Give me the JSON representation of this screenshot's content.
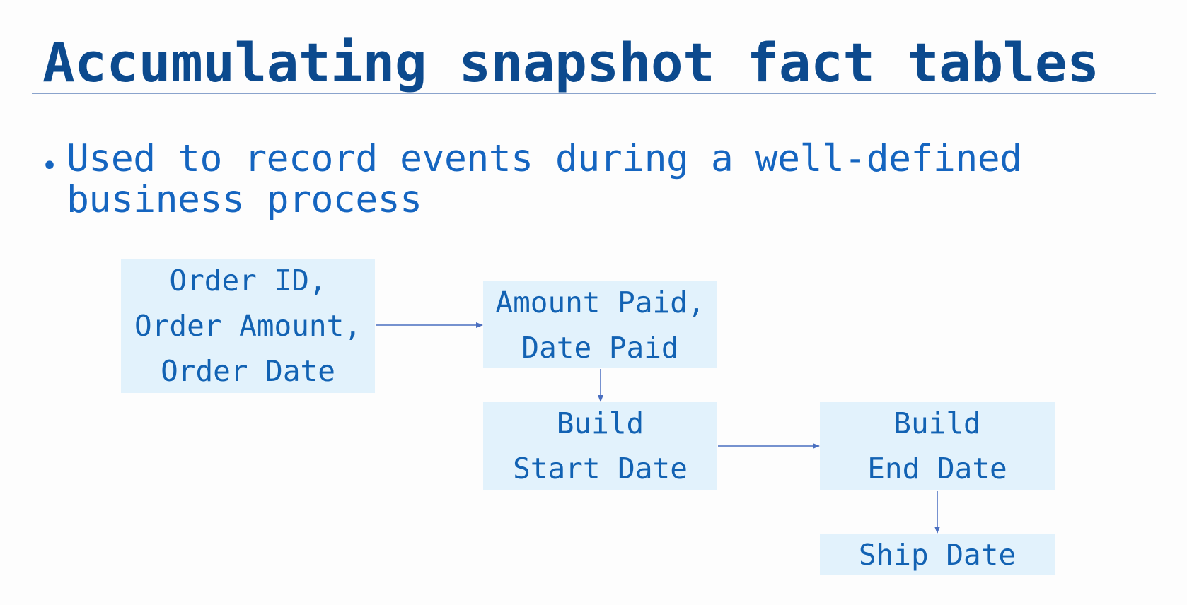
{
  "title": "Accumulating snapshot fact tables",
  "bullet": "Used to record events during a well-defined business process",
  "diagram": {
    "boxes": [
      {
        "lines": [
          "Order ID,",
          "Order Amount,",
          "Order Date"
        ]
      },
      {
        "lines": [
          "Amount Paid,",
          "Date Paid"
        ]
      },
      {
        "lines": [
          "Build",
          "Start Date"
        ]
      },
      {
        "lines": [
          "Build",
          "End Date"
        ]
      },
      {
        "lines": [
          "Ship Date"
        ]
      }
    ]
  },
  "colors": {
    "title": "#0c4a8e",
    "text": "#1262b3",
    "box": "#e2f2fc",
    "arrow": "#4a6fc0"
  }
}
